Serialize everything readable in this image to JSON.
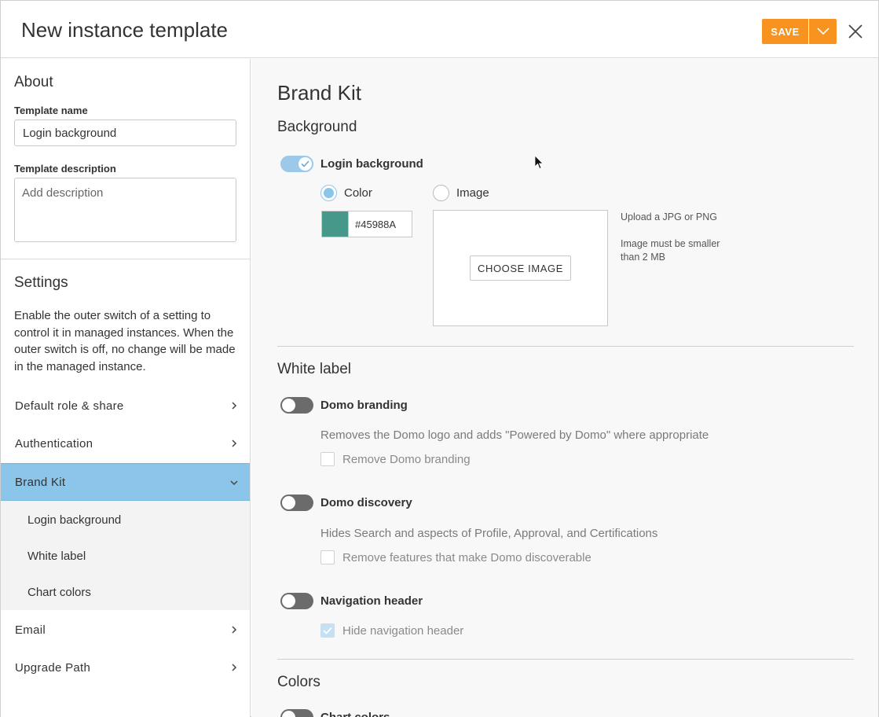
{
  "header": {
    "title": "New instance template",
    "save_label": "SAVE"
  },
  "sidebar": {
    "about_heading": "About",
    "template_name_label": "Template name",
    "template_name_value": "Login background",
    "template_desc_label": "Template description",
    "template_desc_placeholder": "Add description",
    "settings_heading": "Settings",
    "settings_desc": "Enable the outer switch of a setting to control it in managed instances. When the outer switch is off, no change will be made in the managed instance.",
    "items": [
      {
        "label": "Default role & share"
      },
      {
        "label": "Authentication"
      },
      {
        "label": "Brand Kit",
        "active": true
      },
      {
        "label": "Email"
      },
      {
        "label": "Upgrade Path"
      }
    ],
    "sub_items": [
      {
        "label": "Login background"
      },
      {
        "label": "White label"
      },
      {
        "label": "Chart colors"
      }
    ]
  },
  "main": {
    "title": "Brand Kit",
    "background": {
      "heading": "Background",
      "toggle_label": "Login background",
      "toggle_on": true,
      "color_option": "Color",
      "image_option": "Image",
      "selected": "Color",
      "color_hex": "#45988A",
      "swatch_color": "#45988A",
      "choose_image_label": "CHOOSE IMAGE",
      "upload_note_1": "Upload a JPG or PNG",
      "upload_note_2": "Image must be smaller",
      "upload_note_3": "than 2 MB"
    },
    "white_label": {
      "heading": "White label",
      "settings": [
        {
          "label": "Domo branding",
          "toggle_on": false,
          "helper": "Removes the Domo logo and adds \"Powered by Domo\" where appropriate",
          "checkbox_label": "Remove Domo branding",
          "checked": false
        },
        {
          "label": "Domo discovery",
          "toggle_on": false,
          "helper": "Hides Search and aspects of Profile, Approval, and Certifications",
          "checkbox_label": "Remove features that make Domo discoverable",
          "checked": false
        },
        {
          "label": "Navigation header",
          "toggle_on": false,
          "checkbox_label": "Hide navigation header",
          "checked": true
        }
      ]
    },
    "colors": {
      "heading": "Colors",
      "partial_toggle_label": "Chart colors"
    }
  },
  "colors": {
    "accent_orange": "#F7931E",
    "active_blue": "#8CC5EA",
    "toggle_off": "#6B6B6B"
  }
}
